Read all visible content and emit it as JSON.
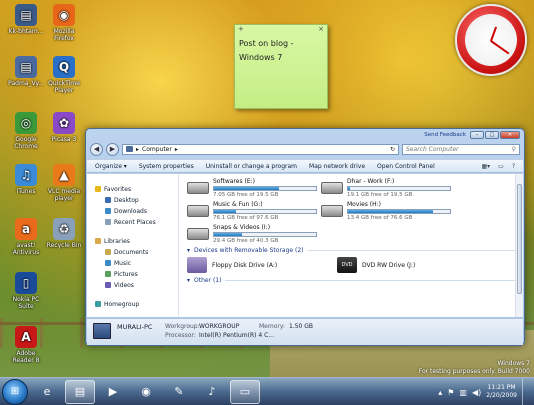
{
  "desktop": {
    "icons": [
      {
        "label": "Kk-bhtam...",
        "glyph": "▤",
        "color": "#3a5a8a",
        "name": "document-icon"
      },
      {
        "label": "Mozilla Firefox",
        "glyph": "◉",
        "color": "#e8661a",
        "name": "firefox-icon"
      },
      {
        "label": "Padma_Vy...",
        "glyph": "▤",
        "color": "#4a6aa0",
        "name": "document-icon"
      },
      {
        "label": "QuickTime Player",
        "glyph": "Q",
        "color": "#2a70c8",
        "name": "quicktime-icon"
      },
      {
        "label": "Google Chrome",
        "glyph": "◎",
        "color": "#3a9a3a",
        "name": "chrome-icon"
      },
      {
        "label": "Picasa 3",
        "glyph": "✿",
        "color": "#8a4ac8",
        "name": "picasa-icon"
      },
      {
        "label": "iTunes",
        "glyph": "♫",
        "color": "#3a8ad8",
        "name": "itunes-icon"
      },
      {
        "label": "VLC media player",
        "glyph": "▲",
        "color": "#e87a1a",
        "name": "vlc-icon"
      },
      {
        "label": "avast! Antivirus",
        "glyph": "a",
        "color": "#e86a1a",
        "name": "avast-icon"
      },
      {
        "label": "Recycle Bin",
        "glyph": "♻",
        "color": "#8aa0b8",
        "name": "recycle-bin-icon"
      },
      {
        "label": "Nokia PC Suite",
        "glyph": "▯",
        "color": "#1a4a9a",
        "name": "nokia-pc-suite-icon"
      },
      {
        "label": "Adobe Reader 8",
        "glyph": "A",
        "color": "#c81818",
        "name": "adobe-reader-icon"
      }
    ]
  },
  "sticky": {
    "add": "+",
    "close": "×",
    "text": "Post on blog -\nWindows 7"
  },
  "explorer": {
    "send_feedback": "Send Feedback",
    "back": "◀",
    "forward": "▶",
    "address": "Computer",
    "search_placeholder": "Search Computer",
    "toolbar": {
      "organize": "Organize ▾",
      "system_properties": "System properties",
      "uninstall": "Uninstall or change a program",
      "map_network": "Map network drive",
      "control_panel": "Open Control Panel"
    },
    "nav": {
      "favorites": "Favorites",
      "desktop": "Desktop",
      "downloads": "Downloads",
      "recent": "Recent Places",
      "libraries": "Libraries",
      "documents": "Documents",
      "music": "Music",
      "pictures": "Pictures",
      "videos": "Videos",
      "homegroup": "Homegroup"
    },
    "drives": [
      {
        "name": "Softwares (E:)",
        "free": "7.05 GB free of 19.5 GB",
        "used_fraction": 0.64
      },
      {
        "name": "Dhar - Work (F:)",
        "free": "19.1 GB free of 19.5 GB",
        "used_fraction": 0.02
      },
      {
        "name": "Music & Fun (G:)",
        "free": "76.1 GB free of 97.6 GB",
        "used_fraction": 0.22
      },
      {
        "name": "Movies (H:)",
        "free": "13.4 GB free of 76.6 GB",
        "used_fraction": 0.83
      },
      {
        "name": "Snaps & Videos (I:)",
        "free": "29.4 GB free of 40.3 GB",
        "used_fraction": 0.27
      }
    ],
    "removable_header": "Devices with Removable Storage (2)",
    "removable": [
      {
        "name": "Floppy Disk Drive (A:)"
      },
      {
        "name": "DVD RW Drive (J:)"
      }
    ],
    "other_header": "Other (1)",
    "details": {
      "pc_name": "MURALI-PC",
      "workgroup_label": "Workgroup:",
      "workgroup": "WORKGROUP",
      "memory_label": "Memory:",
      "memory": "1.50 GB",
      "processor_label": "Processor:",
      "processor": "Intel(R) Pentium(R) 4 C..."
    }
  },
  "watermark": {
    "line1": "Windows 7",
    "line2": "For testing purposes only. Build 7000"
  },
  "taskbar": {
    "time": "11:21 PM",
    "date": "2/20/2009",
    "buttons": [
      {
        "glyph": "e",
        "name": "internet-explorer-icon"
      },
      {
        "glyph": "▤",
        "name": "explorer-folder-icon"
      },
      {
        "glyph": "▶",
        "name": "media-player-icon"
      },
      {
        "glyph": "◉",
        "name": "firefox-taskbar-icon"
      },
      {
        "glyph": "✎",
        "name": "notepad-icon"
      },
      {
        "glyph": "♪",
        "name": "itunes-taskbar-icon"
      },
      {
        "glyph": "▭",
        "name": "sticky-notes-taskbar-icon"
      }
    ]
  }
}
